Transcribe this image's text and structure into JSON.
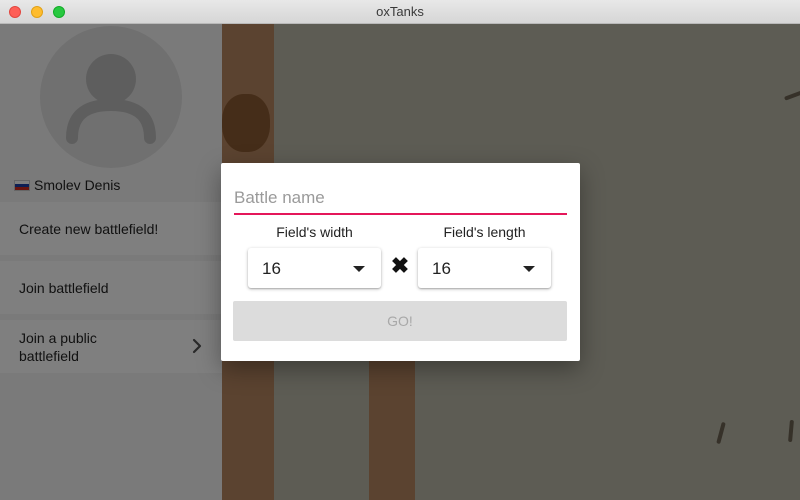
{
  "window": {
    "title": "oxTanks"
  },
  "sidebar": {
    "user_name": "Smolev Denis",
    "flag_icon": "russia-flag-icon",
    "menu": [
      {
        "label": "Create new battlefield!"
      },
      {
        "label": "Join battlefield"
      },
      {
        "label": "Join a public battlefield",
        "icon": "chevron-right-icon"
      }
    ]
  },
  "dialog": {
    "name_placeholder": "Battle name",
    "name_value": "",
    "width_label": "Field's width",
    "width_value": "16",
    "length_label": "Field's length",
    "length_value": "16",
    "times_icon": "multiply-icon",
    "go_label": "GO!"
  },
  "colors": {
    "accent": "#e4175a",
    "overlay": "rgba(0,0,0,0.5)",
    "disabled_button": "#dcdcdc"
  }
}
